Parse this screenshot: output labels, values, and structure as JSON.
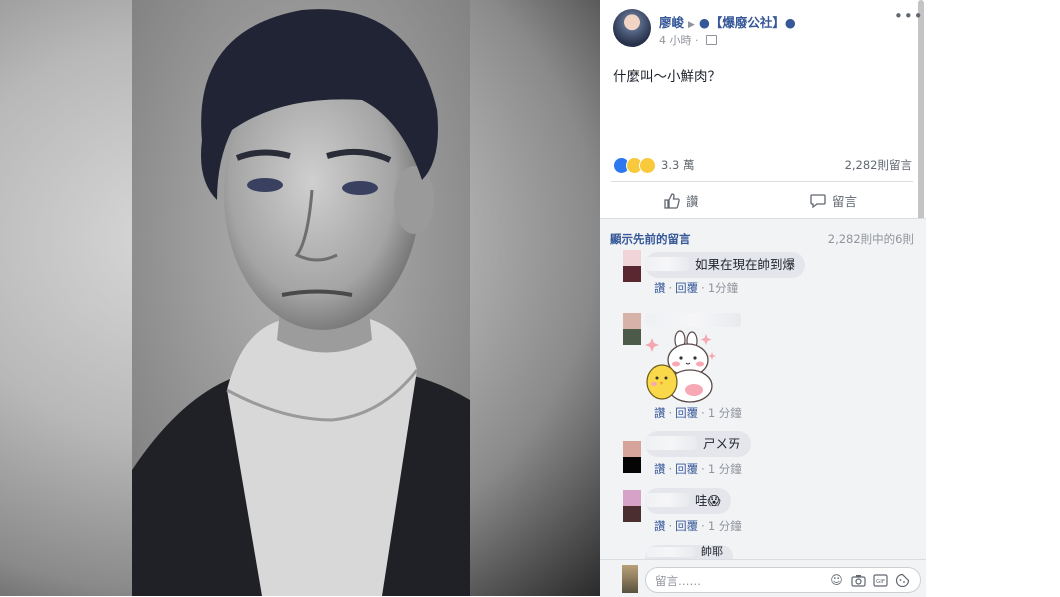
{
  "post": {
    "author": "廖峻",
    "page": "●【爆廢公社】●",
    "time": "4 小時",
    "text": "什麼叫～小鮮肉？",
    "reactions_count": "3.3 萬",
    "comments_count": "2,282則留言",
    "like_label": "讚",
    "comment_label": "留言"
  },
  "comments_section": {
    "prev_link": "顯示先前的留言",
    "range": "2,282則中的6則",
    "items": [
      {
        "text": "如果在現在帥到爆",
        "like": "讚",
        "reply": "回覆",
        "ago": "1分鐘"
      },
      {
        "text": "",
        "like": "讚",
        "reply": "回覆",
        "ago": "1 分鐘"
      },
      {
        "text": "ㄕㄨㄞ",
        "like": "讚",
        "reply": "回覆",
        "ago": "1 分鐘"
      },
      {
        "text": "哇😱",
        "like": "讚",
        "reply": "回覆",
        "ago": "1 分鐘"
      },
      {
        "text": "帥耶",
        "like": "",
        "reply": "",
        "ago": ""
      }
    ]
  },
  "composer": {
    "placeholder": "留言……"
  },
  "icons": [
    "more-icon",
    "privacy-icon",
    "like-icon",
    "comment-icon",
    "emoji-icon",
    "camera-icon",
    "gif-icon",
    "sticker-icon"
  ]
}
